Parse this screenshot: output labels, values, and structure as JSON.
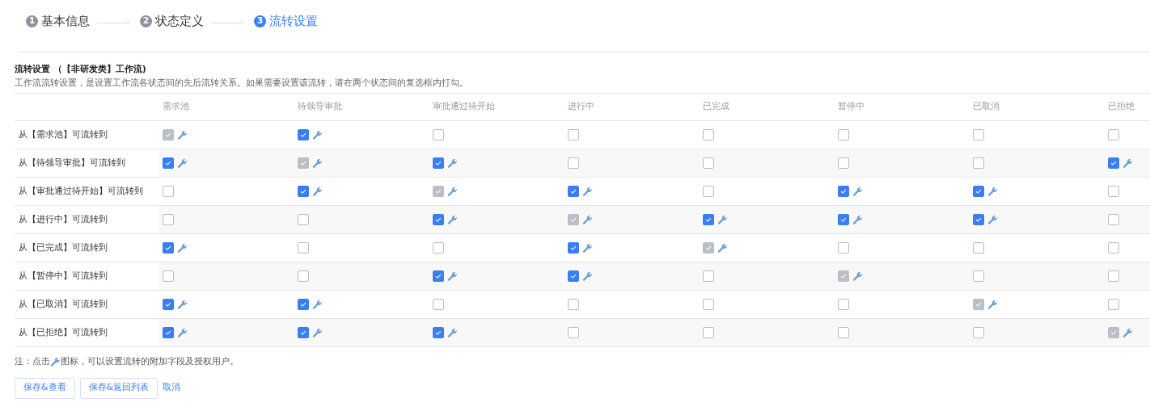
{
  "steps": [
    {
      "number": "1",
      "label": "基本信息",
      "selected": false
    },
    {
      "number": "2",
      "label": "状态定义",
      "selected": false
    },
    {
      "number": "3",
      "label": "流转设置",
      "selected": true
    }
  ],
  "section": {
    "title": "流转设置 （【非研发类】工作流)",
    "description": "工作流流转设置，是设置工作流各状态间的先后流转关系。如果需要设置该流转，请在两个状态间的复选框内打勾。"
  },
  "table": {
    "columns": [
      "需求池",
      "待领导审批",
      "审批通过待开始",
      "进行中",
      "已完成",
      "暂停中",
      "已取消",
      "已拒绝"
    ],
    "rows": [
      {
        "label": "从【需求池】可流转到",
        "cells": [
          {
            "checked": true,
            "disabled": true
          },
          {
            "checked": true,
            "disabled": false
          },
          {
            "checked": false,
            "disabled": false
          },
          {
            "checked": false,
            "disabled": false
          },
          {
            "checked": false,
            "disabled": false
          },
          {
            "checked": false,
            "disabled": false
          },
          {
            "checked": false,
            "disabled": false
          },
          {
            "checked": false,
            "disabled": false
          }
        ]
      },
      {
        "label": "从【待领导审批】可流转到",
        "cells": [
          {
            "checked": true,
            "disabled": false
          },
          {
            "checked": true,
            "disabled": true
          },
          {
            "checked": true,
            "disabled": false
          },
          {
            "checked": false,
            "disabled": false
          },
          {
            "checked": false,
            "disabled": false
          },
          {
            "checked": false,
            "disabled": false
          },
          {
            "checked": false,
            "disabled": false
          },
          {
            "checked": true,
            "disabled": false
          }
        ]
      },
      {
        "label": "从【审批通过待开始】可流转到",
        "cells": [
          {
            "checked": false,
            "disabled": false
          },
          {
            "checked": true,
            "disabled": false
          },
          {
            "checked": true,
            "disabled": true
          },
          {
            "checked": true,
            "disabled": false
          },
          {
            "checked": false,
            "disabled": false
          },
          {
            "checked": true,
            "disabled": false
          },
          {
            "checked": true,
            "disabled": false
          },
          {
            "checked": false,
            "disabled": false
          }
        ]
      },
      {
        "label": "从【进行中】可流转到",
        "cells": [
          {
            "checked": false,
            "disabled": false
          },
          {
            "checked": false,
            "disabled": false
          },
          {
            "checked": true,
            "disabled": false
          },
          {
            "checked": true,
            "disabled": true
          },
          {
            "checked": true,
            "disabled": false
          },
          {
            "checked": true,
            "disabled": false
          },
          {
            "checked": true,
            "disabled": false
          },
          {
            "checked": false,
            "disabled": false
          }
        ]
      },
      {
        "label": "从【已完成】可流转到",
        "cells": [
          {
            "checked": true,
            "disabled": false
          },
          {
            "checked": false,
            "disabled": false
          },
          {
            "checked": false,
            "disabled": false
          },
          {
            "checked": true,
            "disabled": false
          },
          {
            "checked": true,
            "disabled": true
          },
          {
            "checked": false,
            "disabled": false
          },
          {
            "checked": false,
            "disabled": false
          },
          {
            "checked": false,
            "disabled": false
          }
        ]
      },
      {
        "label": "从【暂停中】可流转到",
        "cells": [
          {
            "checked": false,
            "disabled": false
          },
          {
            "checked": false,
            "disabled": false
          },
          {
            "checked": true,
            "disabled": false
          },
          {
            "checked": true,
            "disabled": false
          },
          {
            "checked": false,
            "disabled": false
          },
          {
            "checked": true,
            "disabled": true
          },
          {
            "checked": false,
            "disabled": false
          },
          {
            "checked": false,
            "disabled": false
          }
        ]
      },
      {
        "label": "从【已取消】可流转到",
        "cells": [
          {
            "checked": true,
            "disabled": false
          },
          {
            "checked": true,
            "disabled": false
          },
          {
            "checked": false,
            "disabled": false
          },
          {
            "checked": false,
            "disabled": false
          },
          {
            "checked": false,
            "disabled": false
          },
          {
            "checked": false,
            "disabled": false
          },
          {
            "checked": true,
            "disabled": true
          },
          {
            "checked": false,
            "disabled": false
          }
        ]
      },
      {
        "label": "从【已拒绝】可流转到",
        "cells": [
          {
            "checked": true,
            "disabled": false
          },
          {
            "checked": true,
            "disabled": false
          },
          {
            "checked": true,
            "disabled": false
          },
          {
            "checked": false,
            "disabled": false
          },
          {
            "checked": false,
            "disabled": false
          },
          {
            "checked": false,
            "disabled": false
          },
          {
            "checked": false,
            "disabled": false
          },
          {
            "checked": true,
            "disabled": true
          }
        ]
      }
    ]
  },
  "note": {
    "before_icon": "注：点击",
    "after_icon": "图标，可以设置流转的附加字段及授权用户。"
  },
  "buttons": [
    {
      "kind": "outlined",
      "label": "保存&查看"
    },
    {
      "kind": "outlined",
      "label": "保存&返回列表"
    },
    {
      "kind": "link",
      "label": "取消"
    }
  ]
}
